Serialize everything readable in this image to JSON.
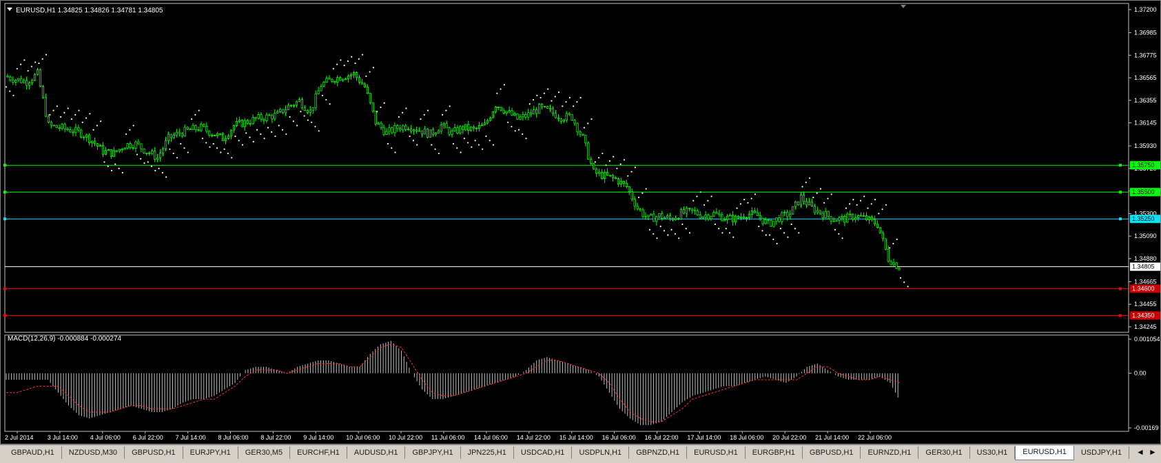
{
  "header": {
    "title": "EURUSD,H1  1.34825 1.34826 1.34781 1.34805"
  },
  "macd": {
    "label": "MACD(12,26,9) -0.000884 -0.000274"
  },
  "colors": {
    "background": "#000000",
    "candle": "#00ff00",
    "sar": "#ffffcc",
    "macd_hist": "#c0c0c0",
    "macd_signal": "#ff3030",
    "axis_text": "#ffffff"
  },
  "chart_data": [
    {
      "type": "candlestick",
      "title": "EURUSD,H1",
      "symbol": "EURUSD",
      "timeframe": "H1",
      "ohlc_current": {
        "open": 1.34825,
        "high": 1.34826,
        "low": 1.34781,
        "close": 1.34805
      },
      "ylim": [
        1.34245,
        1.372
      ],
      "y_ticks": [
        "1.37200",
        "1.36985",
        "1.36775",
        "1.36565",
        "1.36355",
        "1.36145",
        "1.35930",
        "1.35720",
        "1.35510",
        "1.35300",
        "1.35090",
        "1.34880",
        "1.34665",
        "1.34455",
        "1.34245"
      ],
      "x_ticks": [
        "2 Jul 2014",
        "3 Jul 14:00",
        "4 Jul 06:00",
        "6 Jul 22:00",
        "7 Jul 14:00",
        "8 Jul 06:00",
        "8 Jul 22:00",
        "9 Jul 14:00",
        "10 Jul 06:00",
        "10 Jul 22:00",
        "11 Jul 06:00",
        "14 Jul 06:00",
        "14 Jul 22:00",
        "15 Jul 14:00",
        "16 Jul 06:00",
        "16 Jul 22:00",
        "17 Jul 14:00",
        "18 Jul 06:00",
        "20 Jul 22:00",
        "21 Jul 14:00",
        "22 Jul 06:00"
      ],
      "close_path": [
        1.3658,
        1.3655,
        1.3653,
        1.366,
        1.3612,
        1.361,
        1.3608,
        1.3605,
        1.3598,
        1.3588,
        1.3586,
        1.3594,
        1.3595,
        1.3588,
        1.3582,
        1.36,
        1.3605,
        1.3608,
        1.361,
        1.3605,
        1.36,
        1.3612,
        1.3615,
        1.3618,
        1.362,
        1.3622,
        1.363,
        1.3635,
        1.3625,
        1.365,
        1.3655,
        1.3658,
        1.366,
        1.3648,
        1.3615,
        1.3605,
        1.361,
        1.3612,
        1.3608,
        1.3604,
        1.3612,
        1.3605,
        1.361,
        1.3608,
        1.3612,
        1.3632,
        1.3625,
        1.3618,
        1.3622,
        1.3628,
        1.3625,
        1.362,
        1.362,
        1.36,
        1.3568,
        1.3565,
        1.3562,
        1.3555,
        1.3535,
        1.3525,
        1.3528,
        1.3525,
        1.353,
        1.3532,
        1.3528,
        1.353,
        1.3526,
        1.3525,
        1.353,
        1.3528,
        1.352,
        1.3526,
        1.353,
        1.3545,
        1.3535,
        1.353,
        1.3525,
        1.3525,
        1.3528,
        1.3525,
        1.352,
        1.3488,
        1.348
      ],
      "horizontal_levels": [
        {
          "price": "1.35750",
          "color": "#00ff00"
        },
        {
          "price": "1.35500",
          "color": "#00ff00"
        },
        {
          "price": "1.35250",
          "color": "#00e5ff"
        },
        {
          "price": "1.34805",
          "color": "#ffffff"
        },
        {
          "price": "1.34600",
          "color": "#ff0000"
        },
        {
          "price": "1.34350",
          "color": "#ff0000"
        }
      ],
      "indicators": [
        "Parabolic SAR"
      ]
    },
    {
      "type": "bar",
      "title": "MACD(12,26,9)",
      "main": -0.000884,
      "signal": -0.000274,
      "ylim": [
        -0.00169,
        0.001054
      ],
      "y_ticks": [
        "0.001054",
        "0.00",
        "-0.00169"
      ],
      "series": [
        {
          "name": "MACD",
          "values": [
            -0.0002,
            -0.0002,
            -0.0002,
            -0.0002,
            -0.0002,
            -0.0006,
            -0.001,
            -0.0013,
            -0.0014,
            -0.0013,
            -0.0012,
            -0.0011,
            -0.001,
            -0.0011,
            -0.0012,
            -0.0012,
            -0.0011,
            -0.0009,
            -0.0008,
            -0.0008,
            -0.0007,
            -0.0005,
            -0.0003,
            0.0001,
            0.0002,
            0.0002,
            0.0001,
            0.0,
            0.0002,
            0.0003,
            0.0004,
            0.0004,
            0.0003,
            0.0002,
            0.0002,
            0.0006,
            0.0009,
            0.001,
            0.0007,
            0.0,
            -0.0005,
            -0.0008,
            -0.0008,
            -0.0007,
            -0.0006,
            -0.0005,
            -0.0004,
            -0.0003,
            -0.0002,
            -0.0001,
            0.0001,
            0.0004,
            0.0005,
            0.0004,
            0.0003,
            0.0002,
            0.0001,
            -0.0001,
            -0.0006,
            -0.0011,
            -0.0014,
            -0.0016,
            -0.0016,
            -0.0015,
            -0.0012,
            -0.0009,
            -0.0007,
            -0.0006,
            -0.0005,
            -0.0004,
            -0.0004,
            -0.0003,
            -0.0002,
            -0.0001,
            -0.0002,
            -0.0003,
            -0.0001,
            0.0002,
            0.0003,
            0.0001,
            -0.0001,
            -0.0002,
            -0.0002,
            -0.0002,
            -0.0001,
            -0.0003,
            -0.0009
          ]
        },
        {
          "name": "Signal",
          "values": [
            -0.0006,
            -0.0006,
            -0.0005,
            -0.0004,
            -0.0004,
            -0.0004,
            -0.0007,
            -0.001,
            -0.0012,
            -0.0012,
            -0.0012,
            -0.0011,
            -0.001,
            -0.001,
            -0.0011,
            -0.0011,
            -0.0011,
            -0.001,
            -0.0009,
            -0.0008,
            -0.0008,
            -0.0006,
            -0.0004,
            -0.0001,
            0.0001,
            0.0001,
            0.0001,
            0.0,
            0.0001,
            0.0002,
            0.0003,
            0.0003,
            0.0003,
            0.0002,
            0.0002,
            0.0005,
            0.0008,
            0.0009,
            0.0008,
            0.0003,
            -0.0002,
            -0.0006,
            -0.0007,
            -0.0007,
            -0.0006,
            -0.0005,
            -0.0004,
            -0.0003,
            -0.0002,
            -0.0001,
            0.0,
            0.0002,
            0.0004,
            0.0004,
            0.0003,
            0.0002,
            0.0001,
            0.0,
            -0.0003,
            -0.0008,
            -0.0012,
            -0.0014,
            -0.0015,
            -0.0015,
            -0.0013,
            -0.0011,
            -0.0008,
            -0.0007,
            -0.0006,
            -0.0005,
            -0.0004,
            -0.0003,
            -0.0002,
            -0.0002,
            -0.0002,
            -0.0002,
            -0.0002,
            0.0,
            0.0002,
            0.0002,
            0.0,
            -0.0001,
            -0.0002,
            -0.0002,
            -0.0001,
            -0.0002,
            -0.0003
          ]
        }
      ]
    }
  ],
  "tabs": [
    {
      "label": "GBPAUD,H1",
      "active": false
    },
    {
      "label": "NZDUSD,M30",
      "active": false
    },
    {
      "label": "GBPUSD,H1",
      "active": false
    },
    {
      "label": "EURJPY,H1",
      "active": false
    },
    {
      "label": "GER30,M5",
      "active": false
    },
    {
      "label": "EURCHF,H1",
      "active": false
    },
    {
      "label": "AUDUSD,H1",
      "active": false
    },
    {
      "label": "GBPJPY,H1",
      "active": false
    },
    {
      "label": "JPN225,H1",
      "active": false
    },
    {
      "label": "USDCAD,H1",
      "active": false
    },
    {
      "label": "USDPLN,H1",
      "active": false
    },
    {
      "label": "GBPNZD,H1",
      "active": false
    },
    {
      "label": "EURUSD,H1",
      "active": false
    },
    {
      "label": "EURGBP,H1",
      "active": false
    },
    {
      "label": "GBPUSD,H1",
      "active": false
    },
    {
      "label": "EURNZD,H1",
      "active": false
    },
    {
      "label": "GER30,H1",
      "active": false
    },
    {
      "label": "US30,H1",
      "active": false
    },
    {
      "label": "EURUSD,H1",
      "active": true
    },
    {
      "label": "USDJPY,H1",
      "active": false
    }
  ],
  "nav": {
    "left": "◄",
    "right": "►"
  }
}
